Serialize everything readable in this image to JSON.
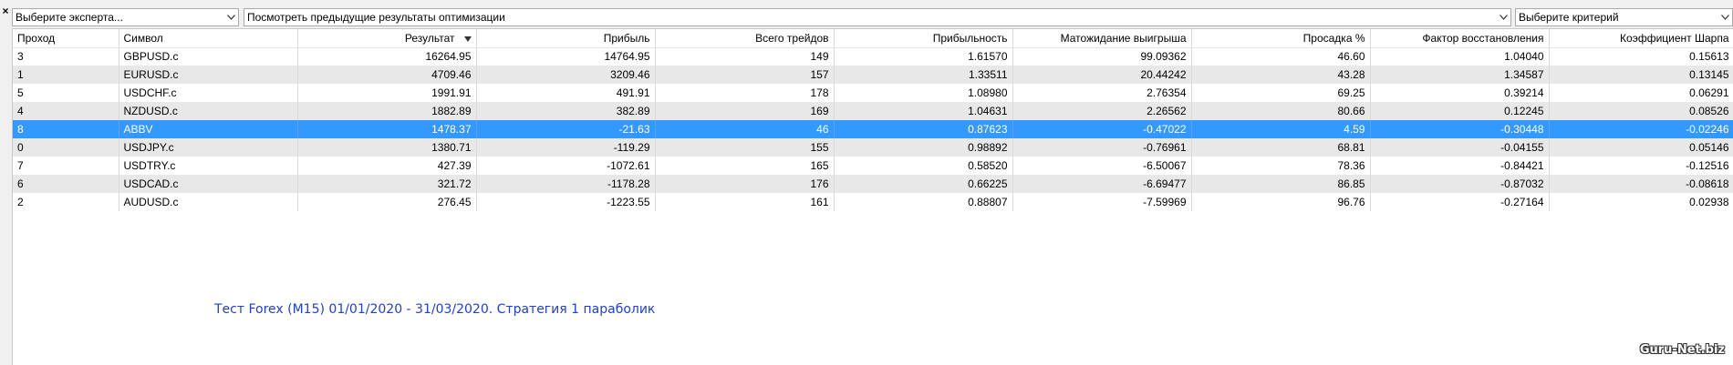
{
  "close_glyph": "×",
  "toolbar": {
    "expert_select": "Выберите эксперта...",
    "previous_results_select": "Посмотреть предыдущие результаты оптимизации",
    "criteria_select": "Выберите критерий"
  },
  "table": {
    "columns": [
      "Проход",
      "Символ",
      "Результат",
      "Прибыль",
      "Всего трейдов",
      "Прибыльность",
      "Матожидание выигрыша",
      "Просадка %",
      "Фактор восстановления",
      "Коэффициент Шарпа"
    ],
    "sorted_column": "Результат",
    "sort_direction": "descending",
    "selected_row_index": 4,
    "rows": [
      [
        "3",
        "GBPUSD.c",
        "16264.95",
        "14764.95",
        "149",
        "1.61570",
        "99.09362",
        "46.60",
        "1.04040",
        "0.15613"
      ],
      [
        "1",
        "EURUSD.c",
        "4709.46",
        "3209.46",
        "157",
        "1.33511",
        "20.44242",
        "43.28",
        "1.34587",
        "0.13145"
      ],
      [
        "5",
        "USDCHF.c",
        "1991.91",
        "491.91",
        "178",
        "1.08980",
        "2.76354",
        "69.25",
        "0.39214",
        "0.06291"
      ],
      [
        "4",
        "NZDUSD.c",
        "1882.89",
        "382.89",
        "169",
        "1.04631",
        "2.26562",
        "80.66",
        "0.12245",
        "0.08526"
      ],
      [
        "8",
        "ABBV",
        "1478.37",
        "-21.63",
        "46",
        "0.87623",
        "-0.47022",
        "4.59",
        "-0.30448",
        "-0.02246"
      ],
      [
        "0",
        "USDJPY.c",
        "1380.71",
        "-119.29",
        "155",
        "0.98892",
        "-0.76961",
        "68.81",
        "-0.04155",
        "0.05146"
      ],
      [
        "7",
        "USDTRY.c",
        "427.39",
        "-1072.61",
        "165",
        "0.58520",
        "-6.50067",
        "78.36",
        "-0.84421",
        "-0.12516"
      ],
      [
        "6",
        "USDCAD.c",
        "321.72",
        "-1178.28",
        "176",
        "0.66225",
        "-6.69477",
        "86.85",
        "-0.87032",
        "-0.08618"
      ],
      [
        "2",
        "AUDUSD.c",
        "276.45",
        "-1223.55",
        "161",
        "0.88807",
        "-7.59969",
        "96.76",
        "-0.27164",
        "0.02938"
      ]
    ]
  },
  "caption": "Тест Forex  (M15) 01/01/2020 - 31/03/2020. Стратегия 1 параболик",
  "watermark": "Guru-Net.biz",
  "colors": {
    "selection": "#3399ff",
    "alt_row": "#e8e8e8",
    "caption_text": "#1f3fd6"
  }
}
